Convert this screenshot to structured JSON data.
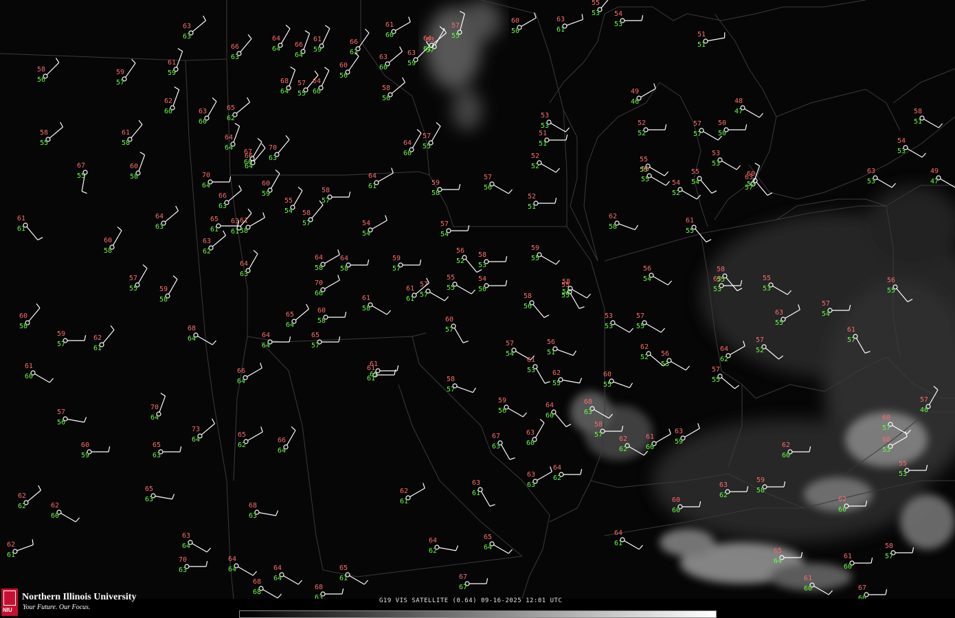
{
  "product_caption": "G19 VIS SATELLITE (0.64) 09-16-2025 12:01 UTC",
  "branding": {
    "university_name": "Northern Illinois University",
    "tagline": "Your Future. Our Focus.",
    "logo_letters": "NIU"
  },
  "colors": {
    "temperature": "#ff6a6a",
    "dewpoint": "#66ff44",
    "station": "#ffffff",
    "boundaries": "#3a3a3a"
  },
  "stations": [
    {
      "t": "58",
      "d": "56"
    },
    {
      "t": "59",
      "d": "57"
    },
    {
      "t": "61",
      "d": "59"
    },
    {
      "t": "63",
      "d": "63"
    },
    {
      "t": "66",
      "d": "63"
    },
    {
      "t": "64",
      "d": "64"
    },
    {
      "t": "66",
      "d": "64"
    },
    {
      "t": "61",
      "d": "59"
    },
    {
      "t": "66",
      "d": "63"
    },
    {
      "t": "63",
      "d": "60"
    },
    {
      "t": "61",
      "d": "60"
    },
    {
      "t": "63",
      "d": "59"
    },
    {
      "t": "63",
      "d": "57"
    },
    {
      "t": "57",
      "d": "55"
    },
    {
      "t": "60",
      "d": "50"
    },
    {
      "t": "63",
      "d": "61"
    },
    {
      "t": "55",
      "d": "53"
    },
    {
      "t": "54",
      "d": "53"
    },
    {
      "t": "51",
      "d": "51"
    },
    {
      "t": "58",
      "d": "55"
    },
    {
      "t": "61",
      "d": "58"
    },
    {
      "t": "62",
      "d": "60"
    },
    {
      "t": "63",
      "d": "60"
    },
    {
      "t": "65",
      "d": "62"
    },
    {
      "t": "64",
      "d": "64"
    },
    {
      "t": "67",
      "d": "66"
    },
    {
      "t": "70",
      "d": "63"
    },
    {
      "t": "68",
      "d": "64"
    },
    {
      "t": "57",
      "d": "55"
    },
    {
      "t": "64",
      "d": "60"
    },
    {
      "t": "60",
      "d": "56"
    },
    {
      "t": "58",
      "d": "56"
    },
    {
      "t": "64",
      "d": "61"
    },
    {
      "t": "53",
      "d": "53"
    },
    {
      "t": "51",
      "d": "51"
    },
    {
      "t": "49",
      "d": "46"
    },
    {
      "t": "52",
      "d": "52"
    },
    {
      "t": "57",
      "d": "57"
    },
    {
      "t": "48",
      "d": "47"
    },
    {
      "t": "58",
      "d": "51"
    },
    {
      "t": "67",
      "d": "55"
    },
    {
      "t": "60",
      "d": "58"
    },
    {
      "t": "70",
      "d": "64"
    },
    {
      "t": "66",
      "d": "63"
    },
    {
      "t": "63",
      "d": "61"
    },
    {
      "t": "64",
      "d": "63"
    },
    {
      "t": "66",
      "d": "64"
    },
    {
      "t": "58",
      "d": "57"
    },
    {
      "t": "64",
      "d": "60"
    },
    {
      "t": "57",
      "d": "55"
    },
    {
      "t": "52",
      "d": "52"
    },
    {
      "t": "55",
      "d": "55"
    },
    {
      "t": "53",
      "d": "53"
    },
    {
      "t": "50",
      "d": "50"
    },
    {
      "t": "54",
      "d": "53"
    },
    {
      "t": "63",
      "d": "57"
    },
    {
      "t": "63",
      "d": "53"
    },
    {
      "t": "64",
      "d": "62"
    },
    {
      "t": "61",
      "d": "61"
    },
    {
      "t": "60",
      "d": "59"
    },
    {
      "t": "64",
      "d": "61"
    },
    {
      "t": "59",
      "d": "58"
    },
    {
      "t": "52",
      "d": "51"
    },
    {
      "t": "57",
      "d": "56"
    },
    {
      "t": "56",
      "d": "55"
    },
    {
      "t": "54",
      "d": "52"
    },
    {
      "t": "55",
      "d": "54"
    },
    {
      "t": "60",
      "d": "52"
    },
    {
      "t": "63",
      "d": "53"
    },
    {
      "t": "49",
      "d": "47"
    },
    {
      "t": "61",
      "d": "61"
    },
    {
      "t": "64",
      "d": "63"
    },
    {
      "t": "65",
      "d": "61"
    },
    {
      "t": "61",
      "d": "58"
    },
    {
      "t": "55",
      "d": "54"
    },
    {
      "t": "58",
      "d": "57"
    },
    {
      "t": "54",
      "d": "54"
    },
    {
      "t": "57",
      "d": "54"
    },
    {
      "t": "62",
      "d": "58"
    },
    {
      "t": "61",
      "d": "55"
    },
    {
      "t": "60",
      "d": "58"
    },
    {
      "t": "63",
      "d": "62"
    },
    {
      "t": "64",
      "d": "58"
    },
    {
      "t": "64",
      "d": "58"
    },
    {
      "t": "59",
      "d": "57"
    },
    {
      "t": "56",
      "d": "52"
    },
    {
      "t": "58",
      "d": "53"
    },
    {
      "t": "59",
      "d": "55"
    },
    {
      "t": "56",
      "d": "54"
    },
    {
      "t": "58",
      "d": "55"
    },
    {
      "t": "57",
      "d": "55"
    },
    {
      "t": "59",
      "d": "58"
    },
    {
      "t": "65",
      "d": "64"
    },
    {
      "t": "60",
      "d": "58"
    },
    {
      "t": "61",
      "d": "58"
    },
    {
      "t": "57",
      "d": "57"
    },
    {
      "t": "55",
      "d": "55"
    },
    {
      "t": "54",
      "d": "50"
    },
    {
      "t": "58",
      "d": "56"
    },
    {
      "t": "55",
      "d": "55"
    },
    {
      "t": "70",
      "d": "66"
    },
    {
      "t": "61",
      "d": "61"
    },
    {
      "t": "58",
      "d": "54"
    },
    {
      "t": "53",
      "d": "53"
    },
    {
      "t": "57",
      "d": "55"
    },
    {
      "t": "55",
      "d": "53"
    },
    {
      "t": "57",
      "d": "52"
    },
    {
      "t": "63",
      "d": "55"
    },
    {
      "t": "57",
      "d": "54"
    },
    {
      "t": "56",
      "d": "55"
    },
    {
      "t": "60",
      "d": "58"
    },
    {
      "t": "59",
      "d": "57"
    },
    {
      "t": "62",
      "d": "61"
    },
    {
      "t": "68",
      "d": "64"
    },
    {
      "t": "64",
      "d": "64"
    },
    {
      "t": "65",
      "d": "57"
    },
    {
      "t": "60",
      "d": "57"
    },
    {
      "t": "57",
      "d": "54"
    },
    {
      "t": "61",
      "d": "53"
    },
    {
      "t": "56",
      "d": "51"
    },
    {
      "t": "61",
      "d": "60"
    },
    {
      "t": "66",
      "d": "64"
    },
    {
      "t": "61",
      "d": "61"
    },
    {
      "t": "58",
      "d": "57"
    },
    {
      "t": "62",
      "d": "55"
    },
    {
      "t": "60",
      "d": "55"
    },
    {
      "t": "62",
      "d": "52"
    },
    {
      "t": "56",
      "d": "53"
    },
    {
      "t": "57",
      "d": "55"
    },
    {
      "t": "61",
      "d": "57"
    },
    {
      "t": "57",
      "d": "56"
    },
    {
      "t": "70",
      "d": "64"
    },
    {
      "t": "65",
      "d": "63"
    },
    {
      "t": "59",
      "d": "56"
    },
    {
      "t": "64",
      "d": "60"
    },
    {
      "t": "68",
      "d": "63"
    },
    {
      "t": "58",
      "d": "57"
    },
    {
      "t": "63",
      "d": "59"
    },
    {
      "t": "60",
      "d": "57"
    },
    {
      "t": "57",
      "d": "46"
    },
    {
      "t": "60",
      "d": "59"
    },
    {
      "t": "73",
      "d": "64"
    },
    {
      "t": "65",
      "d": "62"
    },
    {
      "t": "66",
      "d": "64"
    },
    {
      "t": "67",
      "d": "63"
    },
    {
      "t": "63",
      "d": "60"
    },
    {
      "t": "61",
      "d": "60"
    },
    {
      "t": "62",
      "d": "62"
    },
    {
      "t": "62",
      "d": "60"
    },
    {
      "t": "60",
      "d": "53"
    },
    {
      "t": "62",
      "d": "62"
    },
    {
      "t": "62",
      "d": "60"
    },
    {
      "t": "65",
      "d": "63"
    },
    {
      "t": "68",
      "d": "63"
    },
    {
      "t": "63",
      "d": "61"
    },
    {
      "t": "62",
      "d": "61"
    },
    {
      "t": "63",
      "d": "63"
    },
    {
      "t": "64",
      "d": "62"
    },
    {
      "t": "62",
      "d": "60"
    },
    {
      "t": "55",
      "d": "53"
    },
    {
      "t": "62",
      "d": "61"
    },
    {
      "t": "70",
      "d": "63"
    },
    {
      "t": "64",
      "d": "64"
    },
    {
      "t": "64",
      "d": "64"
    },
    {
      "t": "65",
      "d": "61"
    },
    {
      "t": "64",
      "d": "62"
    },
    {
      "t": "65",
      "d": "64"
    },
    {
      "t": "63",
      "d": "62"
    },
    {
      "t": "61",
      "d": "60"
    },
    {
      "t": "58",
      "d": "57"
    },
    {
      "t": "68",
      "d": "68"
    },
    {
      "t": "68",
      "d": "63"
    },
    {
      "t": "63",
      "d": "64"
    },
    {
      "t": "67",
      "d": "67"
    },
    {
      "t": "64",
      "d": "61"
    },
    {
      "t": "65",
      "d": "64"
    },
    {
      "t": "60",
      "d": "60"
    },
    {
      "t": "59",
      "d": "58"
    },
    {
      "t": "61",
      "d": "60"
    },
    {
      "t": "67",
      "d": "60"
    }
  ]
}
